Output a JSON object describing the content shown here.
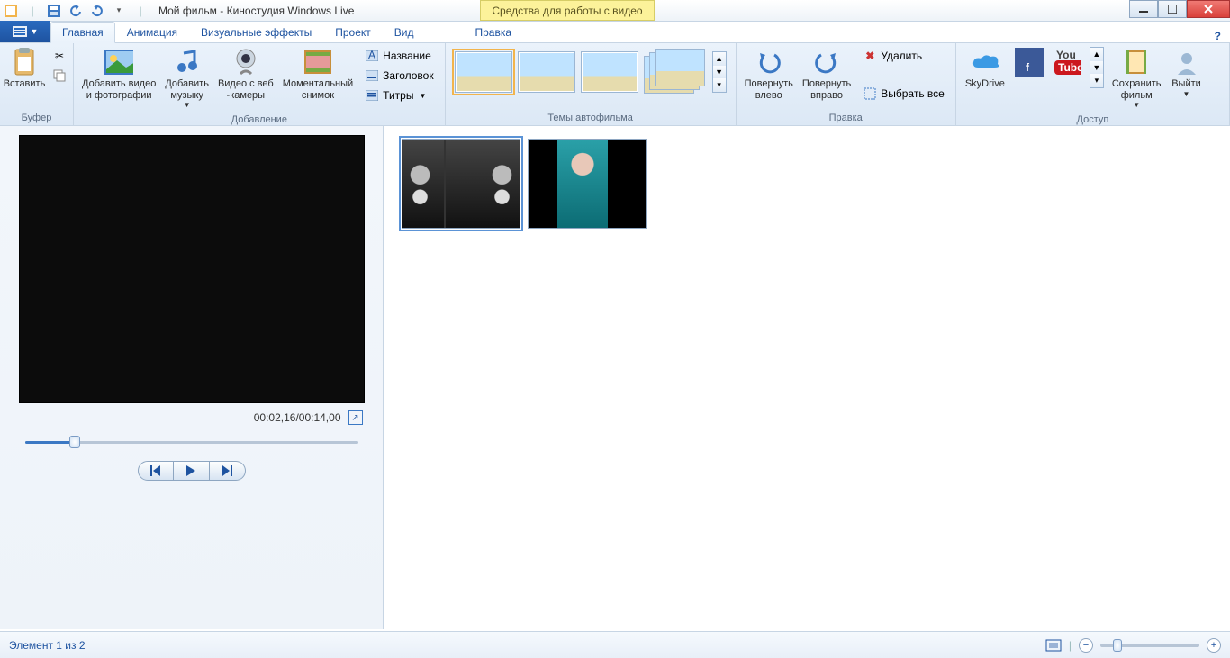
{
  "window": {
    "title": "Мой фильм - Киностудия Windows Live",
    "context_tab": "Средства для работы с видео"
  },
  "tabs": {
    "home": "Главная",
    "animation": "Анимация",
    "visual": "Визуальные эффекты",
    "project": "Проект",
    "view": "Вид",
    "edit": "Правка"
  },
  "ribbon": {
    "clipboard": {
      "paste": "Вставить",
      "group": "Буфер"
    },
    "add": {
      "add_media": "Добавить видео\nи фотографии",
      "add_music": "Добавить\nмузыку",
      "webcam": "Видео с веб\n-камеры",
      "snapshot": "Моментальный\nснимок",
      "title": "Название",
      "caption": "Заголовок",
      "credits": "Титры",
      "group": "Добавление"
    },
    "themes": {
      "group": "Темы автофильма"
    },
    "edit": {
      "rotate_left": "Повернуть\nвлево",
      "rotate_right": "Повернуть\nвправо",
      "delete": "Удалить",
      "select_all": "Выбрать все",
      "group": "Правка"
    },
    "share": {
      "skydrive": "SkyDrive",
      "save_movie": "Сохранить\nфильм",
      "sign_out": "Выйти",
      "group": "Доступ"
    }
  },
  "preview": {
    "timecode": "00:02,16/00:14,00",
    "seek_percent": 15
  },
  "status": {
    "text": "Элемент 1 из 2"
  },
  "icons": {
    "save": "save-icon",
    "undo": "undo-icon",
    "redo": "redo-icon",
    "paste": "clipboard-icon",
    "cut": "scissors-icon",
    "copy": "copy-icon",
    "photo": "photo-icon",
    "music": "music-icon",
    "webcam": "webcam-icon",
    "snapshot": "snapshot-icon",
    "text": "text-icon",
    "rot_l": "rotate-left-icon",
    "rot_r": "rotate-right-icon",
    "delete": "delete-icon",
    "select": "select-all-icon",
    "skydrive": "skydrive-icon",
    "facebook": "facebook-icon",
    "youtube": "youtube-icon",
    "save_movie": "film-icon",
    "user": "user-icon",
    "fullscreen": "fullscreen-icon",
    "prev": "prev-frame-icon",
    "play": "play-icon",
    "next": "next-frame-icon",
    "fit": "fit-icon",
    "zoom_out": "zoom-out-icon",
    "zoom_in": "zoom-in-icon",
    "help": "help-icon"
  }
}
